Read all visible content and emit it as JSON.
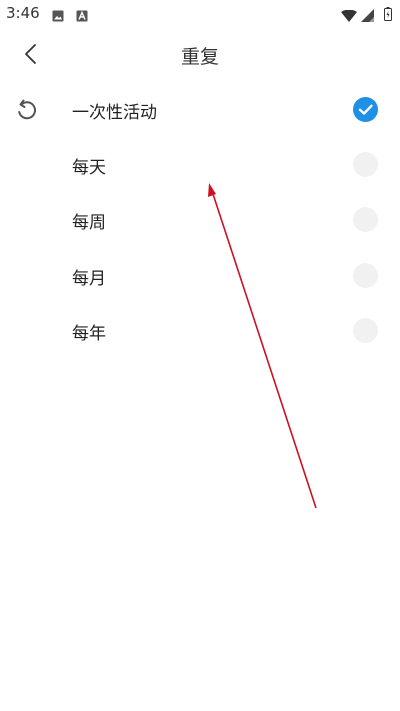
{
  "status_bar": {
    "time": "3:46"
  },
  "header": {
    "title": "重复"
  },
  "options": [
    {
      "label": "一次性活动",
      "selected": true
    },
    {
      "label": "每天",
      "selected": false
    },
    {
      "label": "每周",
      "selected": false
    },
    {
      "label": "每月",
      "selected": false
    },
    {
      "label": "每年",
      "selected": false
    }
  ],
  "colors": {
    "accent": "#1e90e6",
    "annotation_arrow": "#cc1122"
  }
}
